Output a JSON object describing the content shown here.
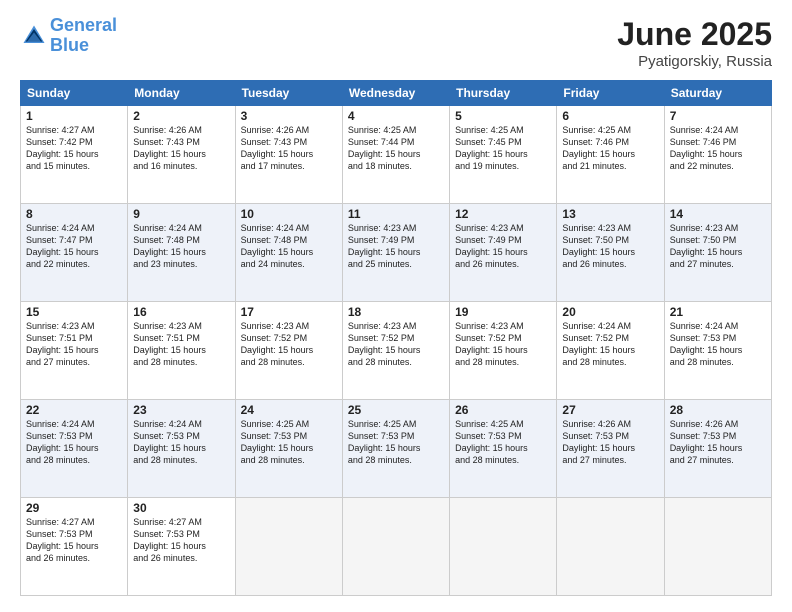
{
  "header": {
    "logo_line1": "General",
    "logo_line2": "Blue",
    "month": "June 2025",
    "location": "Pyatigorskiy, Russia"
  },
  "weekdays": [
    "Sunday",
    "Monday",
    "Tuesday",
    "Wednesday",
    "Thursday",
    "Friday",
    "Saturday"
  ],
  "weeks": [
    [
      {
        "day": "1",
        "info": "Sunrise: 4:27 AM\nSunset: 7:42 PM\nDaylight: 15 hours\nand 15 minutes."
      },
      {
        "day": "2",
        "info": "Sunrise: 4:26 AM\nSunset: 7:43 PM\nDaylight: 15 hours\nand 16 minutes."
      },
      {
        "day": "3",
        "info": "Sunrise: 4:26 AM\nSunset: 7:43 PM\nDaylight: 15 hours\nand 17 minutes."
      },
      {
        "day": "4",
        "info": "Sunrise: 4:25 AM\nSunset: 7:44 PM\nDaylight: 15 hours\nand 18 minutes."
      },
      {
        "day": "5",
        "info": "Sunrise: 4:25 AM\nSunset: 7:45 PM\nDaylight: 15 hours\nand 19 minutes."
      },
      {
        "day": "6",
        "info": "Sunrise: 4:25 AM\nSunset: 7:46 PM\nDaylight: 15 hours\nand 21 minutes."
      },
      {
        "day": "7",
        "info": "Sunrise: 4:24 AM\nSunset: 7:46 PM\nDaylight: 15 hours\nand 22 minutes."
      }
    ],
    [
      {
        "day": "8",
        "info": "Sunrise: 4:24 AM\nSunset: 7:47 PM\nDaylight: 15 hours\nand 22 minutes."
      },
      {
        "day": "9",
        "info": "Sunrise: 4:24 AM\nSunset: 7:48 PM\nDaylight: 15 hours\nand 23 minutes."
      },
      {
        "day": "10",
        "info": "Sunrise: 4:24 AM\nSunset: 7:48 PM\nDaylight: 15 hours\nand 24 minutes."
      },
      {
        "day": "11",
        "info": "Sunrise: 4:23 AM\nSunset: 7:49 PM\nDaylight: 15 hours\nand 25 minutes."
      },
      {
        "day": "12",
        "info": "Sunrise: 4:23 AM\nSunset: 7:49 PM\nDaylight: 15 hours\nand 26 minutes."
      },
      {
        "day": "13",
        "info": "Sunrise: 4:23 AM\nSunset: 7:50 PM\nDaylight: 15 hours\nand 26 minutes."
      },
      {
        "day": "14",
        "info": "Sunrise: 4:23 AM\nSunset: 7:50 PM\nDaylight: 15 hours\nand 27 minutes."
      }
    ],
    [
      {
        "day": "15",
        "info": "Sunrise: 4:23 AM\nSunset: 7:51 PM\nDaylight: 15 hours\nand 27 minutes."
      },
      {
        "day": "16",
        "info": "Sunrise: 4:23 AM\nSunset: 7:51 PM\nDaylight: 15 hours\nand 28 minutes."
      },
      {
        "day": "17",
        "info": "Sunrise: 4:23 AM\nSunset: 7:52 PM\nDaylight: 15 hours\nand 28 minutes."
      },
      {
        "day": "18",
        "info": "Sunrise: 4:23 AM\nSunset: 7:52 PM\nDaylight: 15 hours\nand 28 minutes."
      },
      {
        "day": "19",
        "info": "Sunrise: 4:23 AM\nSunset: 7:52 PM\nDaylight: 15 hours\nand 28 minutes."
      },
      {
        "day": "20",
        "info": "Sunrise: 4:24 AM\nSunset: 7:52 PM\nDaylight: 15 hours\nand 28 minutes."
      },
      {
        "day": "21",
        "info": "Sunrise: 4:24 AM\nSunset: 7:53 PM\nDaylight: 15 hours\nand 28 minutes."
      }
    ],
    [
      {
        "day": "22",
        "info": "Sunrise: 4:24 AM\nSunset: 7:53 PM\nDaylight: 15 hours\nand 28 minutes."
      },
      {
        "day": "23",
        "info": "Sunrise: 4:24 AM\nSunset: 7:53 PM\nDaylight: 15 hours\nand 28 minutes."
      },
      {
        "day": "24",
        "info": "Sunrise: 4:25 AM\nSunset: 7:53 PM\nDaylight: 15 hours\nand 28 minutes."
      },
      {
        "day": "25",
        "info": "Sunrise: 4:25 AM\nSunset: 7:53 PM\nDaylight: 15 hours\nand 28 minutes."
      },
      {
        "day": "26",
        "info": "Sunrise: 4:25 AM\nSunset: 7:53 PM\nDaylight: 15 hours\nand 28 minutes."
      },
      {
        "day": "27",
        "info": "Sunrise: 4:26 AM\nSunset: 7:53 PM\nDaylight: 15 hours\nand 27 minutes."
      },
      {
        "day": "28",
        "info": "Sunrise: 4:26 AM\nSunset: 7:53 PM\nDaylight: 15 hours\nand 27 minutes."
      }
    ],
    [
      {
        "day": "29",
        "info": "Sunrise: 4:27 AM\nSunset: 7:53 PM\nDaylight: 15 hours\nand 26 minutes."
      },
      {
        "day": "30",
        "info": "Sunrise: 4:27 AM\nSunset: 7:53 PM\nDaylight: 15 hours\nand 26 minutes."
      },
      {
        "day": "",
        "info": ""
      },
      {
        "day": "",
        "info": ""
      },
      {
        "day": "",
        "info": ""
      },
      {
        "day": "",
        "info": ""
      },
      {
        "day": "",
        "info": ""
      }
    ]
  ]
}
